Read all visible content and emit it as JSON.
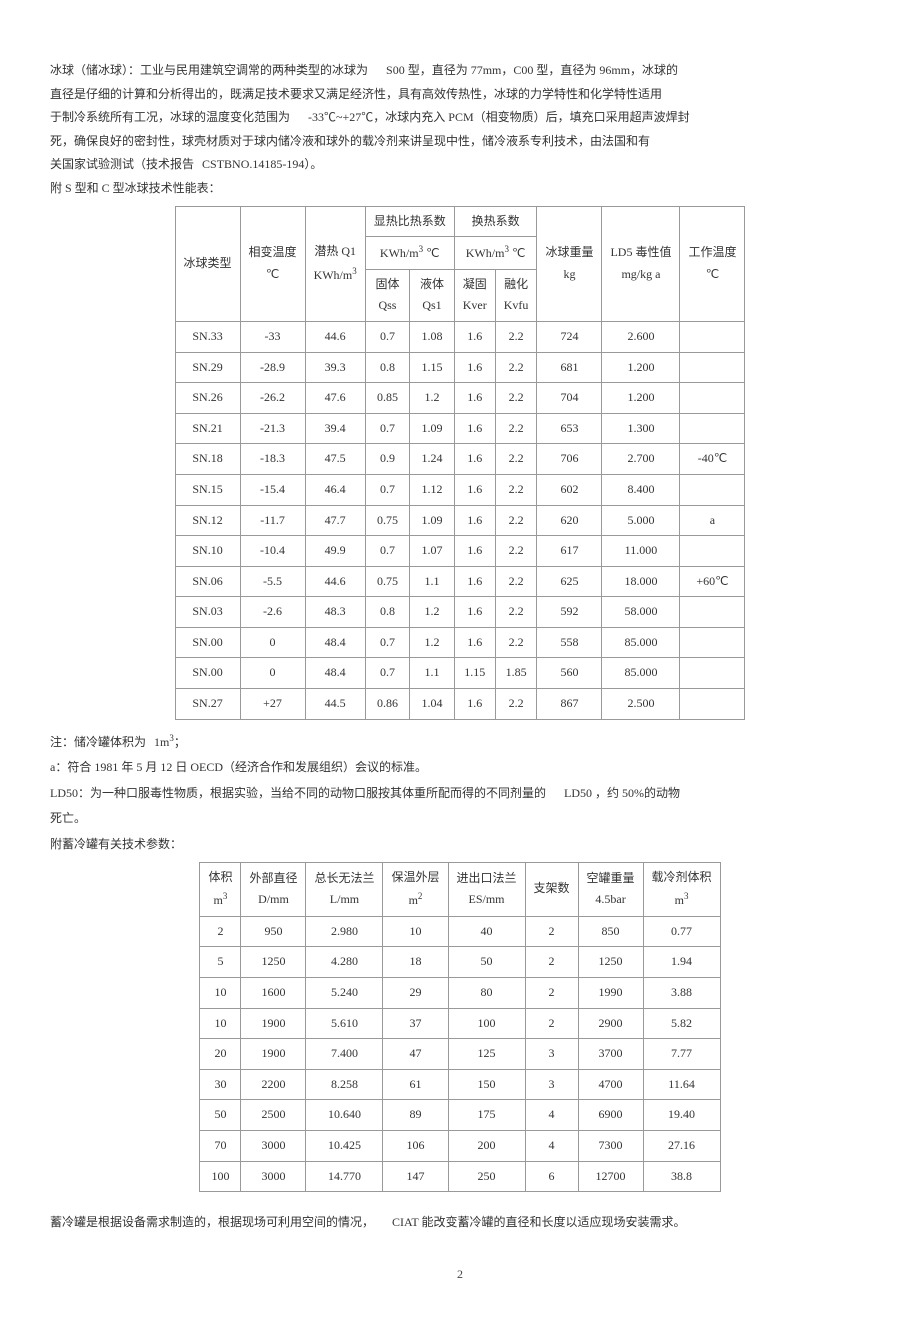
{
  "title_para": {
    "seg1": "冰球（储冰球）：工业与民用建筑空调常的两种类型的冰球为",
    "seg2": "S00 型，直径为 77mm，C00 型，直径为 96mm，冰球的",
    "line2": "直径是仔细的计算和分析得出的，既满足技术要求又满足经济性，具有高效传热性，冰球的力学特性和化学特性适用",
    "seg3": "于制冷系统所有工况，冰球的温度变化范围为",
    "seg4": "-33℃~+27℃，冰球内充入  PCM（相变物质）后，填充口采用超声波焊封",
    "line4": "死，确保良好的密封性，球壳材质对于球内储冷液和球外的载冷剂来讲呈现中性，储冷液系专利技术，由法国和有",
    "seg5": "关国家试验测试（技术报告",
    "seg6": "CSTBNO.14185-194）。"
  },
  "table1_caption": "附 S 型和 C 型冰球技术性能表：",
  "table1": {
    "headers": {
      "c1": "冰球类型",
      "c2": "相变温度",
      "c2u": "℃",
      "c3": "潜热 Q1",
      "c3u_a": "KWh/m",
      "c3u_b": "3",
      "c4": "显热比热系数",
      "c4u_a": "KWh/m",
      "c4u_b": "3",
      "c4u_c": " ℃",
      "c4s1": "固体",
      "c4s1b": "Qss",
      "c4s2": "液体",
      "c4s2b": "Qs1",
      "c5": "换热系数",
      "c5u_a": "KWh/m",
      "c5u_b": "3",
      "c5u_c": " ℃",
      "c5s1": "凝固",
      "c5s1b": "Kver",
      "c5s2": "融化",
      "c5s2b": "Kvfu",
      "c6": "冰球重量",
      "c6u": "kg",
      "c7": "LD5 毒性值",
      "c7u": "mg/kg a",
      "c8": "工作温度",
      "c8u": "℃"
    },
    "rows": [
      {
        "c1": "SN.33",
        "c2": "-33",
        "c3": "44.6",
        "c4a": "0.7",
        "c4b": "1.08",
        "c5a": "1.6",
        "c5b": "2.2",
        "c6": "724",
        "c7": "2.600",
        "c8": ""
      },
      {
        "c1": "SN.29",
        "c2": "-28.9",
        "c3": "39.3",
        "c4a": "0.8",
        "c4b": "1.15",
        "c5a": "1.6",
        "c5b": "2.2",
        "c6": "681",
        "c7": "1.200",
        "c8": ""
      },
      {
        "c1": "SN.26",
        "c2": "-26.2",
        "c3": "47.6",
        "c4a": "0.85",
        "c4b": "1.2",
        "c5a": "1.6",
        "c5b": "2.2",
        "c6": "704",
        "c7": "1.200",
        "c8": ""
      },
      {
        "c1": "SN.21",
        "c2": "-21.3",
        "c3": "39.4",
        "c4a": "0.7",
        "c4b": "1.09",
        "c5a": "1.6",
        "c5b": "2.2",
        "c6": "653",
        "c7": "1.300",
        "c8": ""
      },
      {
        "c1": "SN.18",
        "c2": "-18.3",
        "c3": "47.5",
        "c4a": "0.9",
        "c4b": "1.24",
        "c5a": "1.6",
        "c5b": "2.2",
        "c6": "706",
        "c7": "2.700",
        "c8": "-40℃"
      },
      {
        "c1": "SN.15",
        "c2": "-15.4",
        "c3": "46.4",
        "c4a": "0.7",
        "c4b": "1.12",
        "c5a": "1.6",
        "c5b": "2.2",
        "c6": "602",
        "c7": "8.400",
        "c8": ""
      },
      {
        "c1": "SN.12",
        "c2": "-11.7",
        "c3": "47.7",
        "c4a": "0.75",
        "c4b": "1.09",
        "c5a": "1.6",
        "c5b": "2.2",
        "c6": "620",
        "c7": "5.000",
        "c8": "a"
      },
      {
        "c1": "SN.10",
        "c2": "-10.4",
        "c3": "49.9",
        "c4a": "0.7",
        "c4b": "1.07",
        "c5a": "1.6",
        "c5b": "2.2",
        "c6": "617",
        "c7": "11.000",
        "c8": ""
      },
      {
        "c1": "SN.06",
        "c2": "-5.5",
        "c3": "44.6",
        "c4a": "0.75",
        "c4b": "1.1",
        "c5a": "1.6",
        "c5b": "2.2",
        "c6": "625",
        "c7": "18.000",
        "c8": "+60℃"
      },
      {
        "c1": "SN.03",
        "c2": "-2.6",
        "c3": "48.3",
        "c4a": "0.8",
        "c4b": "1.2",
        "c5a": "1.6",
        "c5b": "2.2",
        "c6": "592",
        "c7": "58.000",
        "c8": ""
      },
      {
        "c1": "SN.00",
        "c2": "0",
        "c3": "48.4",
        "c4a": "0.7",
        "c4b": "1.2",
        "c5a": "1.6",
        "c5b": "2.2",
        "c6": "558",
        "c7": "85.000",
        "c8": ""
      },
      {
        "c1": "SN.00",
        "c2": "0",
        "c3": "48.4",
        "c4a": "0.7",
        "c4b": "1.1",
        "c5a": "1.15",
        "c5b": "1.85",
        "c6": "560",
        "c7": "85.000",
        "c8": ""
      },
      {
        "c1": "SN.27",
        "c2": "+27",
        "c3": "44.5",
        "c4a": "0.86",
        "c4b": "1.04",
        "c5a": "1.6",
        "c5b": "2.2",
        "c6": "867",
        "c7": "2.500",
        "c8": ""
      }
    ]
  },
  "notes1": {
    "n1a": "注：储冷罐体积为",
    "n1b": "1m",
    "n1c": "3",
    "n1d": "；",
    "n2": "a：符合 1981 年 5 月 12 日 OECD（经济合作和发展组织）会议的标准。",
    "n3a": "LD50：为一种口服毒性物质，根据实验，当给不同的动物口服按其体重所配而得的不同剂量的",
    "n3b": "LD50 ，约 50%的动物",
    "n3c": "死亡。"
  },
  "table2_caption": "附蓄冷罐有关技术参数：",
  "table2": {
    "headers": {
      "c1a": "体积",
      "c1b": "m",
      "c1c": "3",
      "c2a": "外部直径",
      "c2b": "D/mm",
      "c3a": "总长无法兰",
      "c3b": "L/mm",
      "c4a": "保温外层",
      "c4b": "m",
      "c4c": "2",
      "c5a": "进出口法兰",
      "c5b": "ES/mm",
      "c6": "支架数",
      "c7a": "空罐重量",
      "c7b": "4.5bar",
      "c8a": "载冷剂体积",
      "c8b": "m",
      "c8c": "3"
    },
    "rows": [
      {
        "c1": "2",
        "c2": "950",
        "c3": "2.980",
        "c4": "10",
        "c5": "40",
        "c6": "2",
        "c7": "850",
        "c8": "0.77"
      },
      {
        "c1": "5",
        "c2": "1250",
        "c3": "4.280",
        "c4": "18",
        "c5": "50",
        "c6": "2",
        "c7": "1250",
        "c8": "1.94"
      },
      {
        "c1": "10",
        "c2": "1600",
        "c3": "5.240",
        "c4": "29",
        "c5": "80",
        "c6": "2",
        "c7": "1990",
        "c8": "3.88"
      },
      {
        "c1": "10",
        "c2": "1900",
        "c3": "5.610",
        "c4": "37",
        "c5": "100",
        "c6": "2",
        "c7": "2900",
        "c8": "5.82"
      },
      {
        "c1": "20",
        "c2": "1900",
        "c3": "7.400",
        "c4": "47",
        "c5": "125",
        "c6": "3",
        "c7": "3700",
        "c8": "7.77"
      },
      {
        "c1": "30",
        "c2": "2200",
        "c3": "8.258",
        "c4": "61",
        "c5": "150",
        "c6": "3",
        "c7": "4700",
        "c8": "11.64"
      },
      {
        "c1": "50",
        "c2": "2500",
        "c3": "10.640",
        "c4": "89",
        "c5": "175",
        "c6": "4",
        "c7": "6900",
        "c8": "19.40"
      },
      {
        "c1": "70",
        "c2": "3000",
        "c3": "10.425",
        "c4": "106",
        "c5": "200",
        "c6": "4",
        "c7": "7300",
        "c8": "27.16"
      },
      {
        "c1": "100",
        "c2": "3000",
        "c3": "14.770",
        "c4": "147",
        "c5": "250",
        "c6": "6",
        "c7": "12700",
        "c8": "38.8"
      }
    ]
  },
  "footer_para": {
    "seg1": "蓄冷罐是根据设备需求制造的，根据现场可利用空间的情况，",
    "seg2": "CIAT 能改变蓄冷罐的直径和长度以适应现场安装需求。"
  },
  "page_number": "2"
}
